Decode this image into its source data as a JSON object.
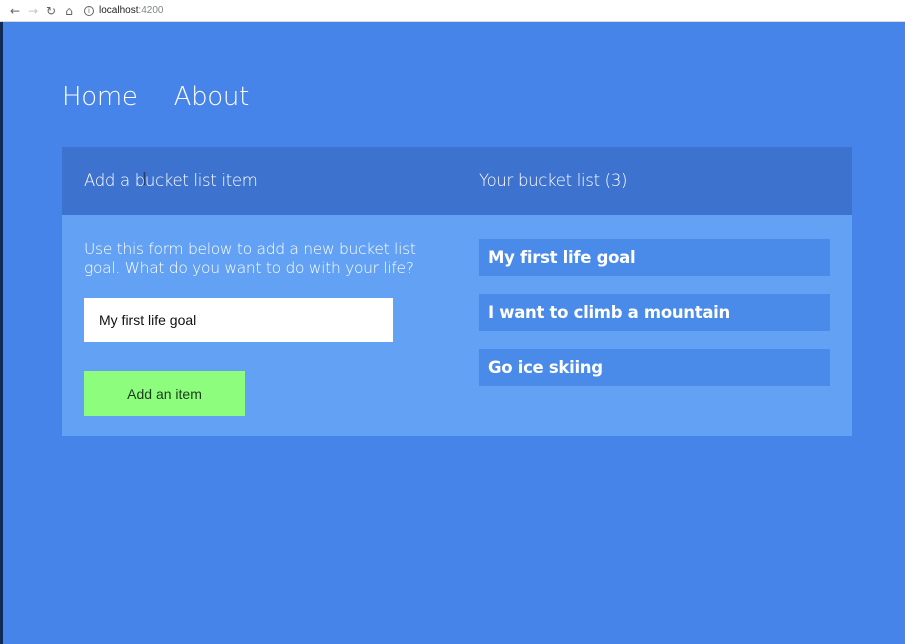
{
  "browser": {
    "url_host": "localhost",
    "url_port": ":4200"
  },
  "nav": {
    "home_label": "Home",
    "about_label": "About"
  },
  "form": {
    "title": "Add a bucket list item",
    "intro": "Use this form below to add a new bucket list goal. What do you want to do with your life?",
    "input_value": "My first life goal",
    "button_label": "Add an item"
  },
  "list": {
    "title": "Your bucket list (3)",
    "items": [
      "My first life goal",
      "I want to climb a mountain",
      "Go ice skiing"
    ]
  },
  "colors": {
    "background": "#4784e9",
    "header": "#3d73cf",
    "card": "#62a1f3",
    "item": "#4a8ae9",
    "button": "#8dfd7d"
  },
  "icons": [
    "back-arrow-icon",
    "forward-arrow-icon",
    "reload-icon",
    "home-icon",
    "info-icon",
    "text-cursor-icon"
  ]
}
